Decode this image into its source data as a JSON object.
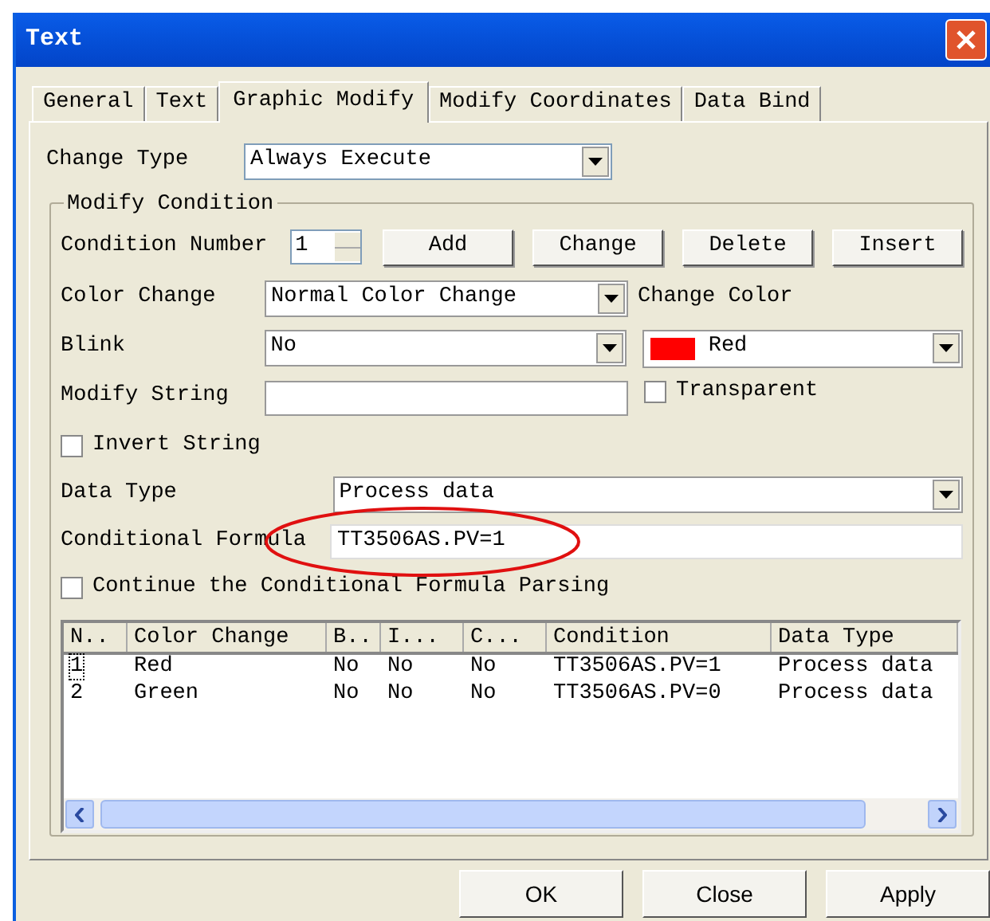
{
  "window": {
    "title": "Text"
  },
  "tabs": [
    {
      "label": "General",
      "selected": false
    },
    {
      "label": "Text",
      "selected": false
    },
    {
      "label": "Graphic Modify",
      "selected": true
    },
    {
      "label": "Modify Coordinates",
      "selected": false
    },
    {
      "label": "Data Bind",
      "selected": false
    }
  ],
  "change_type": {
    "label": "Change Type",
    "value": "Always Execute"
  },
  "modify_condition": {
    "title": "Modify Condition",
    "condition_number": {
      "label": "Condition Number",
      "value": "1"
    },
    "buttons": [
      "Add",
      "Change",
      "Delete",
      "Insert"
    ],
    "color_change": {
      "label": "Color Change",
      "value": "Normal Color Change"
    },
    "change_color": {
      "label": "Change Color",
      "value": "Red",
      "color": "#ff0000"
    },
    "blink": {
      "label": "Blink",
      "value": "No"
    },
    "modify_string": {
      "label": "Modify String"
    },
    "transparent": {
      "label": "Transparent",
      "checked": false
    },
    "invert_string": {
      "label": "Invert String",
      "checked": false
    },
    "data_type": {
      "label": "Data Type",
      "value": "Process data"
    },
    "conditional_formula": {
      "label": "Conditional Formula",
      "value": "TT3506AS.PV=1",
      "highlighted": true
    },
    "continue_parsing": {
      "label": "Continue the Conditional Formula Parsing",
      "checked": false
    },
    "table": {
      "columns": [
        "N..",
        "Color Change",
        "B..",
        "I...",
        "C...",
        "Condition",
        "Data Type"
      ],
      "rows": [
        {
          "cells": [
            "1",
            "Red",
            "No",
            "No",
            "No",
            "TT3506AS.PV=1",
            "Process data"
          ],
          "focused": true
        },
        {
          "cells": [
            "2",
            "Green",
            "No",
            "No",
            "No",
            "TT3506AS.PV=0",
            "Process data"
          ],
          "focused": false
        }
      ]
    }
  },
  "buttons": [
    "OK",
    "Close",
    "Apply"
  ]
}
